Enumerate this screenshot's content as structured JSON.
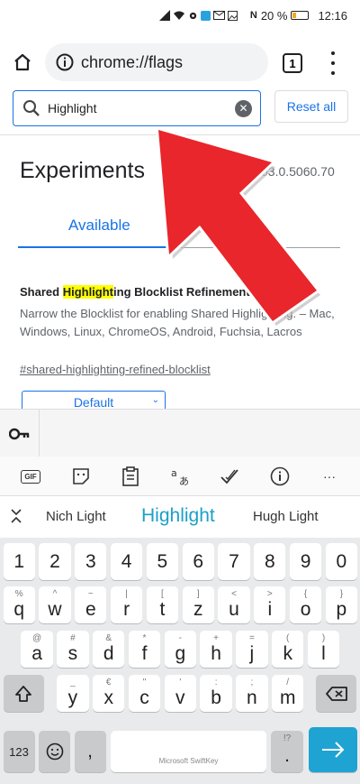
{
  "status_bar": {
    "battery": "20 %",
    "time": "12:16"
  },
  "browser": {
    "url": "chrome://flags",
    "tab_count": "1"
  },
  "flags": {
    "search_value": "Highlight",
    "reset_label": "Reset all",
    "title": "Experiments",
    "version": "03.0.5060.70",
    "tabs": {
      "available": "Available",
      "unavailable_partial": "ilable"
    },
    "experiment": {
      "name_before": "Shared ",
      "name_highlight": "Highlight",
      "name_after": "ing Blocklist Refinement",
      "description": "Narrow the Blocklist for enabling Shared Highlighting. – Mac, Windows, Linux, ChromeOS, Android, Fuchsia, Lacros",
      "link": "#shared-highlighting-refined-blocklist",
      "select_value": "Default"
    }
  },
  "keyboard": {
    "suggestions": {
      "left": "Nich Light",
      "center": "Highlight",
      "right": "Hugh Light"
    },
    "tools": {
      "gif": "GIF",
      "more": "···"
    },
    "number_row": [
      "1",
      "2",
      "3",
      "4",
      "5",
      "6",
      "7",
      "8",
      "9",
      "0"
    ],
    "row1": [
      {
        "hint": "%",
        "key": "q"
      },
      {
        "hint": "^",
        "key": "w"
      },
      {
        "hint": "~",
        "key": "e"
      },
      {
        "hint": "|",
        "key": "r"
      },
      {
        "hint": "[",
        "key": "t"
      },
      {
        "hint": "]",
        "key": "z"
      },
      {
        "hint": "<",
        "key": "u"
      },
      {
        "hint": ">",
        "key": "i"
      },
      {
        "hint": "{",
        "key": "o"
      },
      {
        "hint": "}",
        "key": "p"
      }
    ],
    "row2": [
      {
        "hint": "@",
        "key": "a"
      },
      {
        "hint": "#",
        "key": "s"
      },
      {
        "hint": "&",
        "key": "d"
      },
      {
        "hint": "*",
        "key": "f"
      },
      {
        "hint": "-",
        "key": "g"
      },
      {
        "hint": "+",
        "key": "h"
      },
      {
        "hint": "=",
        "key": "j"
      },
      {
        "hint": "(",
        "key": "k"
      },
      {
        "hint": ")",
        "key": "l"
      }
    ],
    "row3": [
      {
        "hint": "_",
        "key": "y"
      },
      {
        "hint": "€",
        "key": "x"
      },
      {
        "hint": "\"",
        "key": "c"
      },
      {
        "hint": "'",
        "key": "v"
      },
      {
        "hint": ":",
        "key": "b"
      },
      {
        "hint": ";",
        "key": "n"
      },
      {
        "hint": "/",
        "key": "m"
      }
    ],
    "symbols_key": "123",
    "comma_key": ",",
    "space_label": "Microsoft SwiftKey",
    "period_hint": "!?",
    "period_key": ".",
    "enter_icon": "arrow-right-icon"
  },
  "colors": {
    "accent": "#1a73e8",
    "highlight": "#ffff00",
    "arrow": "#e8262b",
    "enter_key": "#1ea3d3"
  }
}
